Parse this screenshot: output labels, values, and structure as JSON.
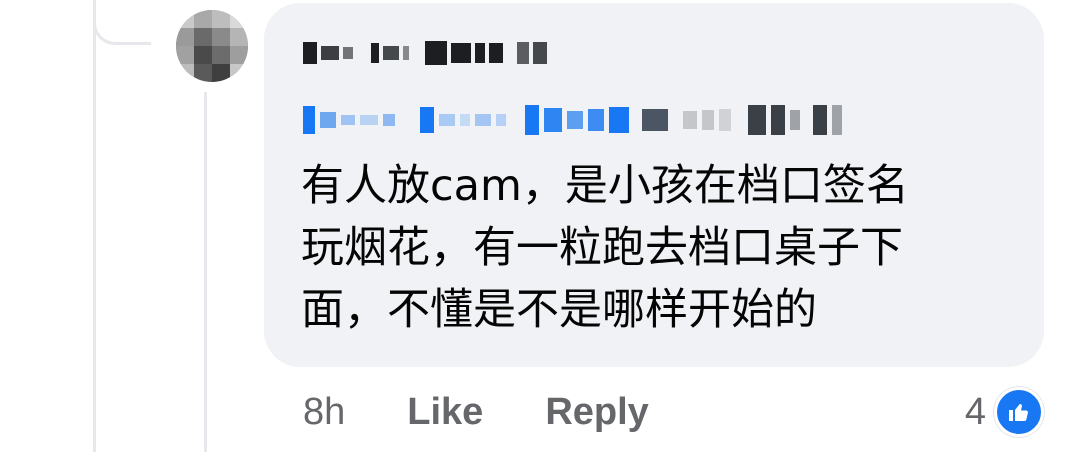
{
  "comment": {
    "author_name": "Fr·· ··dr Mo·d AF",
    "tagged_name": "Y·· ·· ··· ··· Hng ··· ·· ·· ·",
    "text": "有人放cam，是小孩在档口签名\n玩烟花，有一粒跑去档口桌子下\n面，不懂是不是哪样开始的",
    "time": "8h",
    "like_label": "Like",
    "reply_label": "Reply",
    "reaction_count": "4"
  },
  "colors": {
    "bubble": "#f0f2f5",
    "text": "#050505",
    "meta": "#65676b",
    "link_blue": "#1877f2"
  },
  "icons": {
    "reaction": "thumbs-up-icon"
  }
}
